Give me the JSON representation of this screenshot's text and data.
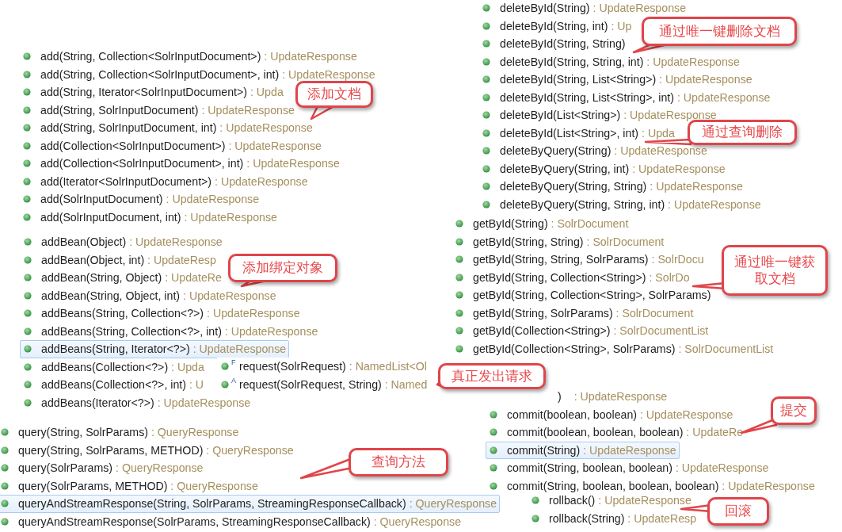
{
  "groups": [
    {
      "kind": "list",
      "rows": [
        {
          "sig": "add(String, Collection<SolrInputDocument>)",
          "ret": ": UpdateResponse",
          "selected": false
        },
        {
          "sig": "add(String, Collection<SolrInputDocument>, int)",
          "ret": ": UpdateResponse",
          "selected": false
        },
        {
          "sig": "add(String, Iterator<SolrInputDocument>)",
          "ret": ": Upda",
          "selected": false
        },
        {
          "sig": "add(String, SolrInputDocument)",
          "ret": ": UpdateResponse",
          "selected": false
        },
        {
          "sig": "add(String, SolrInputDocument, int)",
          "ret": ": UpdateResponse",
          "selected": false
        },
        {
          "sig": "add(Collection<SolrInputDocument>)",
          "ret": ": UpdateResponse",
          "selected": false
        },
        {
          "sig": "add(Collection<SolrInputDocument>, int)",
          "ret": ": UpdateResponse",
          "selected": false
        },
        {
          "sig": "add(Iterator<SolrInputDocument>)",
          "ret": ": UpdateResponse",
          "selected": false
        },
        {
          "sig": "add(SolrInputDocument)",
          "ret": ": UpdateResponse",
          "selected": false
        },
        {
          "sig": "add(SolrInputDocument, int)",
          "ret": ": UpdateResponse",
          "selected": false
        }
      ]
    },
    {
      "kind": "list",
      "rows": [
        {
          "sig": "addBean(Object)",
          "ret": ": UpdateResponse",
          "selected": false
        },
        {
          "sig": "addBean(Object, int)",
          "ret": ": UpdateResp",
          "selected": false
        },
        {
          "sig": "addBean(String, Object)",
          "ret": ": UpdateRe",
          "selected": false
        },
        {
          "sig": "addBean(String, Object, int)",
          "ret": ": UpdateResponse",
          "selected": false
        },
        {
          "sig": "addBeans(String, Collection<?>)",
          "ret": ": UpdateResponse",
          "selected": false
        },
        {
          "sig": "addBeans(String, Collection<?>, int)",
          "ret": ": UpdateResponse",
          "selected": false
        },
        {
          "sig": "addBeans(String, Iterator<?>)",
          "ret": ": UpdateResponse",
          "selected": true
        },
        {
          "sig": "addBeans(Collection<?>)",
          "ret": ": Upda",
          "selected": false
        },
        {
          "sig": "addBeans(Collection<?>, int)",
          "ret": ": U",
          "selected": false
        },
        {
          "sig": "addBeans(Iterator<?>)",
          "ret": ": UpdateResponse",
          "selected": false
        }
      ]
    },
    {
      "kind": "popup",
      "rows": [
        {
          "sig": "request(SolrRequest)",
          "ret": ": NamedList<Ol",
          "marker": "F",
          "selected": false
        },
        {
          "sig": "request(SolrRequest, String)",
          "ret": ": Named",
          "marker": "A",
          "selected": false
        }
      ]
    },
    {
      "kind": "list",
      "rows": [
        {
          "sig": "query(String, SolrParams)",
          "ret": ": QueryResponse",
          "selected": false
        },
        {
          "sig": "query(String, SolrParams, METHOD)",
          "ret": ": QueryResponse",
          "selected": false
        },
        {
          "sig": "query(SolrParams)",
          "ret": ": QueryResponse",
          "selected": false
        },
        {
          "sig": "query(SolrParams, METHOD)",
          "ret": ": QueryResponse",
          "selected": false
        },
        {
          "sig": "queryAndStreamResponse(String, SolrParams, StreamingResponseCallback)",
          "ret": ": QueryResponse",
          "selected": true
        },
        {
          "sig": "queryAndStreamResponse(SolrParams, StreamingResponseCallback)",
          "ret": ": QueryResponse",
          "selected": false
        }
      ]
    },
    {
      "kind": "list",
      "rows": [
        {
          "sig": "deleteById(String)",
          "ret": ": UpdateResponse",
          "selected": false
        },
        {
          "sig": "deleteById(String, int)",
          "ret": ": Up",
          "selected": false
        },
        {
          "sig": "deleteById(String, String)",
          "selected": false
        },
        {
          "sig": "deleteById(String, String, int)",
          "ret": ": UpdateResponse",
          "selected": false
        },
        {
          "sig": "deleteById(String, List<String>)",
          "ret": ": UpdateResponse",
          "selected": false
        },
        {
          "sig": "deleteById(String, List<String>, int)",
          "ret": ": UpdateResponse",
          "selected": false
        },
        {
          "sig": "deleteById(List<String>)",
          "ret": ": UpdateResponse",
          "selected": false
        },
        {
          "sig": "deleteById(List<String>, int)",
          "ret": ": Upda",
          "selected": false
        },
        {
          "sig": "deleteByQuery(String)",
          "ret": ": UpdateResponse",
          "selected": false
        },
        {
          "sig": "deleteByQuery(String, int)",
          "ret": ": UpdateResponse",
          "selected": false
        },
        {
          "sig": "deleteByQuery(String, String)",
          "ret": ": UpdateResponse",
          "selected": false
        },
        {
          "sig": "deleteByQuery(String, String, int)",
          "ret": ": UpdateResponse",
          "selected": false
        }
      ]
    },
    {
      "kind": "list",
      "rows": [
        {
          "sig": "getById(String)",
          "ret": ": SolrDocument",
          "selected": false
        },
        {
          "sig": "getById(String, String)",
          "ret": ": SolrDocument",
          "selected": false
        },
        {
          "sig": "getById(String, String, SolrParams)",
          "ret": ": SolrDocu",
          "selected": false
        },
        {
          "sig": "getById(String, Collection<String>)",
          "ret": ": SolrDo",
          "selected": false
        },
        {
          "sig": "getById(String, Collection<String>, SolrParams)",
          "selected": false
        },
        {
          "sig": "getById(String, SolrParams)",
          "ret": ": SolrDocument",
          "selected": false
        },
        {
          "sig": "getById(Collection<String>)",
          "ret": ": SolrDocumentList",
          "selected": false
        },
        {
          "sig": "getById(Collection<String>, SolrParams)",
          "ret": ": SolrDocumentList",
          "selected": false
        }
      ]
    },
    {
      "kind": "list",
      "rows": [
        {
          "kind": "partial",
          "sig": ")",
          "ret": ": UpdateResponse",
          "selected": false
        },
        {
          "kind": "method",
          "sig": "commit(boolean, boolean)",
          "ret": ": UpdateResponse",
          "selected": false
        },
        {
          "kind": "method",
          "sig": "commit(boolean, boolean, boolean)",
          "ret": ": UpdateRe",
          "selected": false
        },
        {
          "kind": "method",
          "sig": "commit(String)",
          "ret": ": UpdateResponse",
          "selected": true
        },
        {
          "kind": "method",
          "sig": "commit(String, boolean, boolean)",
          "ret": ": UpdateResponse",
          "selected": false
        },
        {
          "kind": "method",
          "sig": "commit(String, boolean, boolean, boolean)",
          "ret": ": UpdateResponse",
          "selected": false
        }
      ]
    },
    {
      "kind": "list",
      "rows": [
        {
          "sig": "rollback()",
          "ret": ": UpdateResponse",
          "selected": false
        },
        {
          "sig": "rollback(String)",
          "ret": ": UpdateResp",
          "selected": false
        }
      ]
    }
  ],
  "callouts": [
    {
      "text": "添加文档"
    },
    {
      "text": "添加绑定对象"
    },
    {
      "text": "通过唯一键删除文档"
    },
    {
      "text": "通过查询删除"
    },
    {
      "text": "通过唯一键获取文档"
    },
    {
      "text": "真正发出请求"
    },
    {
      "text": "提交"
    },
    {
      "text": "查询方法"
    },
    {
      "text": "回滚"
    }
  ]
}
